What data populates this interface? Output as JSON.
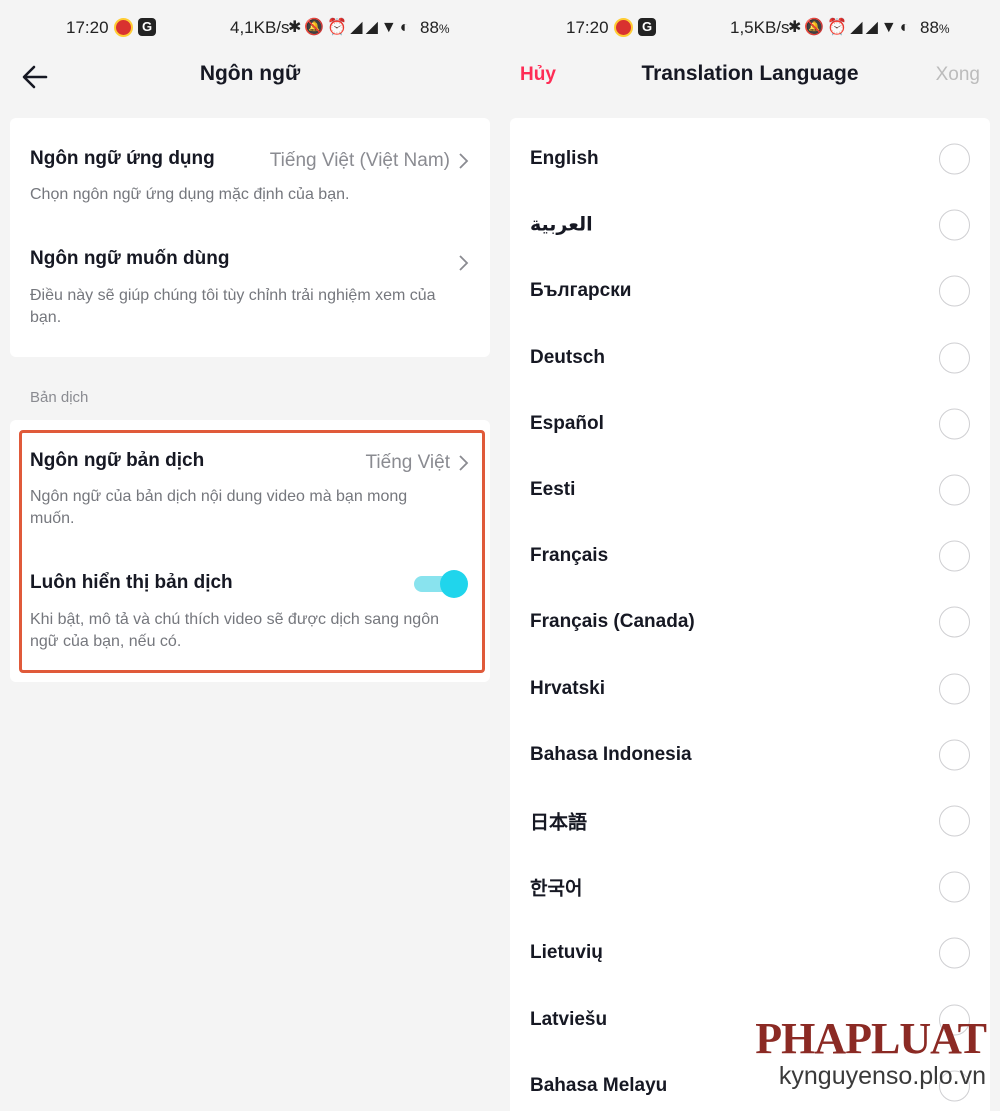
{
  "left_screen": {
    "status": {
      "time": "17:20",
      "g_label": "G",
      "speed": "4,1KB/s",
      "battery": "88",
      "battery_unit": "%"
    },
    "nav": {
      "title": "Ngôn ngữ"
    },
    "app_language": {
      "title": "Ngôn ngữ ứng dụng",
      "value": "Tiếng Việt (Việt Nam)",
      "desc": "Chọn ngôn ngữ ứng dụng mặc định của bạn."
    },
    "preferred_language": {
      "title": "Ngôn ngữ muốn dùng",
      "desc": "Điều này sẽ giúp chúng tôi tùy chỉnh trải nghiệm xem của bạn."
    },
    "section_label": "Bản dịch",
    "translation_language": {
      "title": "Ngôn ngữ bản dịch",
      "value": "Tiếng Việt",
      "desc": "Ngôn ngữ của bản dịch nội dung video mà bạn mong muốn."
    },
    "always_show": {
      "title": "Luôn hiển thị bản dịch",
      "desc": "Khi bật, mô tả và chú thích video sẽ được dịch sang ngôn ngữ của bạn, nếu có.",
      "enabled": true
    }
  },
  "right_screen": {
    "status": {
      "time": "17:20",
      "g_label": "G",
      "speed": "1,5KB/s",
      "battery": "88",
      "battery_unit": "%"
    },
    "nav": {
      "cancel": "Hủy",
      "title": "Translation Language",
      "done": "Xong"
    },
    "languages": [
      "English",
      "العربية",
      "Български",
      "Deutsch",
      "Español",
      "Eesti",
      "Français",
      "Français (Canada)",
      "Hrvatski",
      "Bahasa Indonesia",
      "日本語",
      "한국어",
      "Lietuvių",
      "Latviešu",
      "Bahasa Melayu"
    ]
  },
  "watermark": {
    "brand": "PHAPLUAT",
    "site": "kynguyenso.plo.vn"
  },
  "colors": {
    "accent_red": "#fe2c55",
    "toggle": "#20d5ec",
    "highlight": "#e05a3a"
  }
}
